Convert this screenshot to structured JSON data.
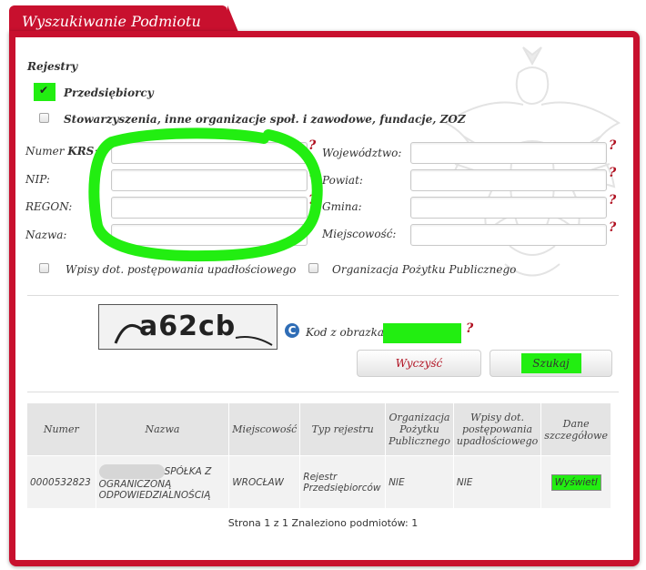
{
  "tab": {
    "title": "Wyszukiwanie Podmiotu"
  },
  "registers": {
    "heading": "Rejestry",
    "entrepreneurs": "Przedsiębiorcy",
    "associations": "Stowarzyszenia, inne organizacje społ. i zawodowe, fundacje, ZOZ"
  },
  "form": {
    "krs_label_prefix": "Numer",
    "krs_label_bold": "KRS",
    "krs_label_suffix": ":",
    "nip_label": "NIP:",
    "regon_label": "REGON:",
    "name_label": "Nazwa:",
    "voivodeship_label": "Województwo:",
    "district_label": "Powiat:",
    "commune_label": "Gmina:",
    "locality_label": "Miejscowość:",
    "help_mark": "?",
    "bankruptcy_label": "Wpisy dot. postępowania upadłościowego",
    "public_benefit_label": "Organizacja Pożytku Publicznego"
  },
  "captcha": {
    "image_text": "a62cb",
    "code_label": "Kod z obrazka:",
    "refresh_glyph": "C"
  },
  "buttons": {
    "clear": "Wyczyść",
    "search": "Szukaj"
  },
  "results": {
    "headers": [
      "Numer",
      "Nazwa",
      "Miejscowość",
      "Typ rejestru",
      "Organizacja Pożytku Publicznego",
      "Wpisy dot. postępowania upadłościowego",
      "Dane szczegółowe"
    ],
    "row": {
      "number": "0000532823",
      "name_line1": "SPÓŁKA Z",
      "name_line2": "OGRANICZONĄ",
      "name_line3": "ODPOWIEDZIALNOŚCIĄ",
      "locality": "WROCŁAW",
      "register_type": "Rejestr Przedsiębiorców",
      "public_benefit": "NIE",
      "bankruptcy": "NIE",
      "details_button": "Wyświetl"
    }
  },
  "pagination": {
    "text": "Strona 1 z 1 Znaleziono podmiotów: 1"
  },
  "colors": {
    "brand_red": "#c8102e",
    "highlight_green": "#22ee11"
  }
}
